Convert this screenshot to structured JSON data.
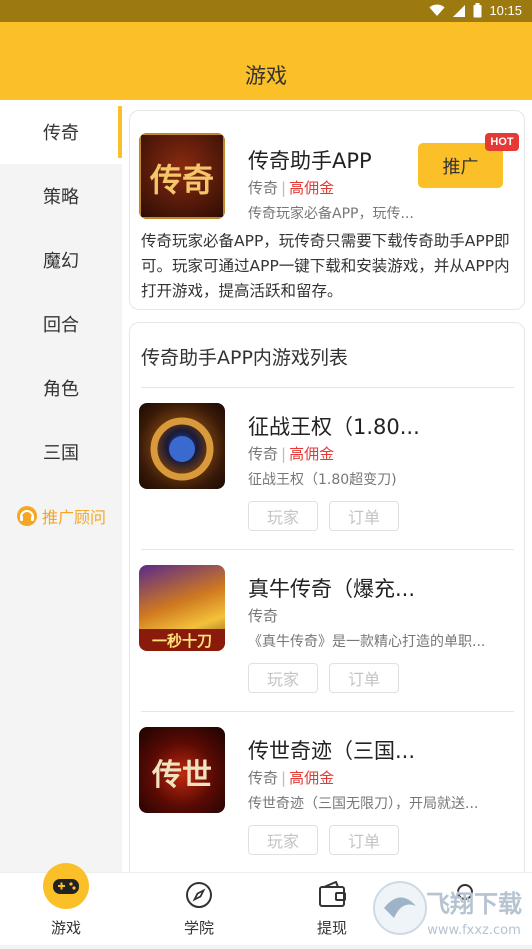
{
  "status": {
    "time": "10:15"
  },
  "header": {
    "title": "游戏"
  },
  "sidebar": {
    "items": [
      {
        "label": "传奇"
      },
      {
        "label": "策略"
      },
      {
        "label": "魔幻"
      },
      {
        "label": "回合"
      },
      {
        "label": "角色"
      },
      {
        "label": "三国"
      }
    ],
    "advisor_label": "推广顾问"
  },
  "featured": {
    "title": "传奇助手APP",
    "category": "传奇",
    "commission": "高佣金",
    "short_desc": "传奇玩家必备APP，玩传...",
    "promo_button": "推广",
    "hot_badge": "HOT",
    "long_desc": "传奇玩家必备APP，玩传奇只需要下载传奇助手APP即可。玩家可通过APP一键下载和安装游戏，并从APP内打开游戏，提高活跃和留存。",
    "icon_text": "传奇"
  },
  "game_list": {
    "heading": "传奇助手APP内游戏列表",
    "player_label": "玩家",
    "order_label": "订单",
    "games": [
      {
        "title": "征战王权（1.80...",
        "category": "传奇",
        "commission": "高佣金",
        "desc": "征战王权（1.80超变刀)"
      },
      {
        "title": "真牛传奇（爆充...",
        "category": "传奇",
        "commission": "",
        "desc": "《真牛传奇》是一款精心打造的单职...",
        "icon_text": "一秒十刀"
      },
      {
        "title": "传世奇迹（三国...",
        "category": "传奇",
        "commission": "高佣金",
        "desc": "传世奇迹（三国无限刀），开局就送...",
        "icon_text": "传世"
      }
    ]
  },
  "bottom_nav": {
    "items": [
      {
        "label": "游戏"
      },
      {
        "label": "学院"
      },
      {
        "label": "提现"
      }
    ]
  },
  "watermark": {
    "text": "飞翔下载",
    "url": "www.fxxz.com"
  },
  "colors": {
    "accent": "#fbbf27",
    "red": "#e53935"
  }
}
